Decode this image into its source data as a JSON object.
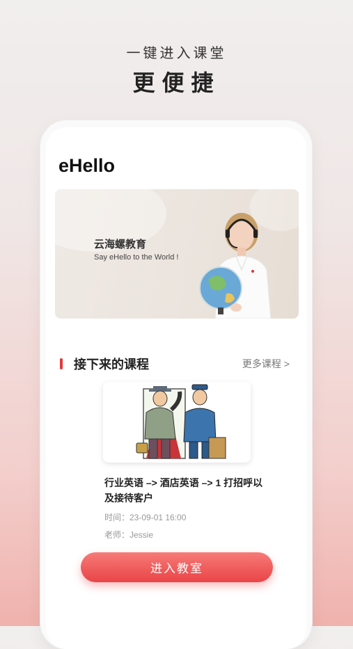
{
  "promo": {
    "subtitle": "一键进入课堂",
    "title": "更便捷"
  },
  "app": {
    "title": "eHello"
  },
  "banner": {
    "brand": "云海螺教育",
    "slogan": "Say eHello to the World !"
  },
  "section": {
    "title": "接下来的课程",
    "more_label": "更多课程 >"
  },
  "course": {
    "name": "行业英语 –> 酒店英语 –> 1 打招呼以及接待客户",
    "time": "时间：23-09-01 16:00",
    "teacher": "老师：Jessie"
  },
  "actions": {
    "enter_label": "进入教室"
  },
  "colors": {
    "accent": "#e4393c",
    "button_top": "#f57b78",
    "button_bottom": "#ea4447"
  }
}
